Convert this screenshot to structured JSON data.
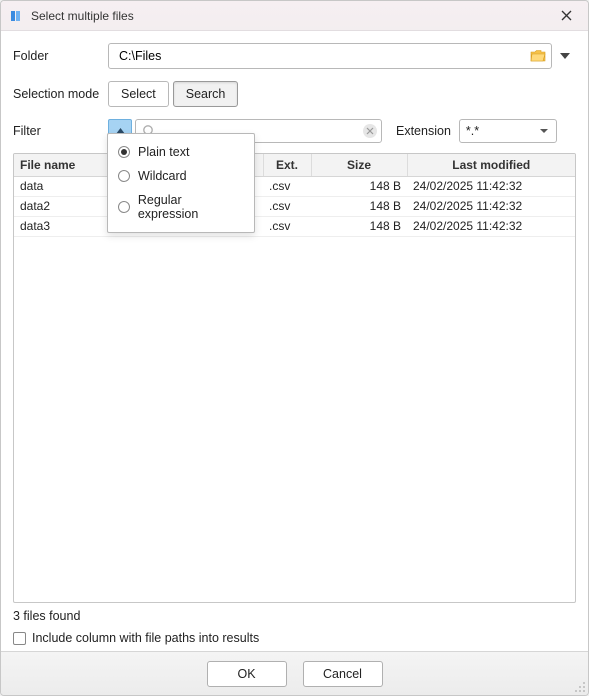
{
  "title": "Select multiple files",
  "folder": {
    "label": "Folder",
    "value": "C:\\Files"
  },
  "selection_mode": {
    "label": "Selection mode",
    "options": [
      "Select",
      "Search"
    ],
    "selected": "Search"
  },
  "filter": {
    "label": "Filter",
    "search_value": "",
    "popup": {
      "options": [
        "Plain text",
        "Wildcard",
        "Regular expression"
      ],
      "selected": "Plain text"
    }
  },
  "extension": {
    "label": "Extension",
    "value": "*.*"
  },
  "table": {
    "columns": [
      "File name",
      "Ext.",
      "Size",
      "Last modified"
    ],
    "rows": [
      {
        "name": "data",
        "ext": ".csv",
        "size": "148 B",
        "modified": "24/02/2025 11:42:32"
      },
      {
        "name": "data2",
        "ext": ".csv",
        "size": "148 B",
        "modified": "24/02/2025 11:42:32"
      },
      {
        "name": "data3",
        "ext": ".csv",
        "size": "148 B",
        "modified": "24/02/2025 11:42:32"
      }
    ]
  },
  "status": "3 files found",
  "include_paths_label": "Include column with file paths into results",
  "buttons": {
    "ok": "OK",
    "cancel": "Cancel"
  }
}
